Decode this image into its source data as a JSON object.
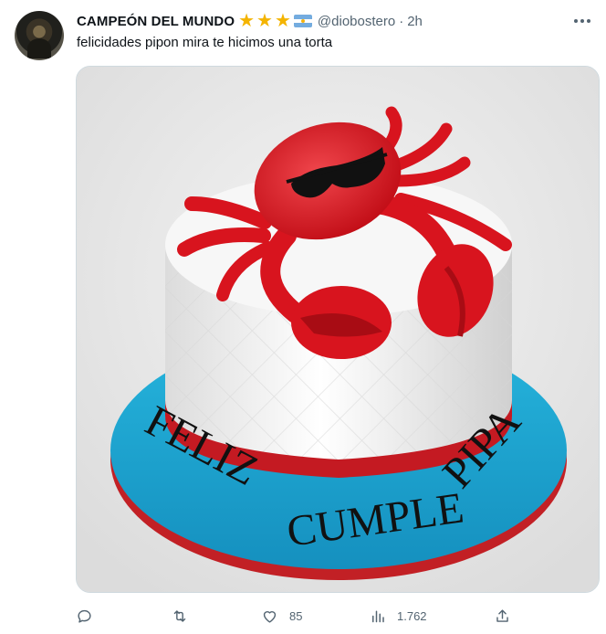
{
  "tweet": {
    "display_name": "CAMPEÓN DEL MUNDO",
    "badges": [
      "star-icon",
      "star-icon",
      "star-icon",
      "argentina-flag-icon"
    ],
    "handle": "@diobostero",
    "separator": "·",
    "time": "2h",
    "text": "felicidades pipon mira te hicimos una torta"
  },
  "media": {
    "cake_text": {
      "line1": "FELIZ",
      "line2": "CUMPLE",
      "line3": "PIPA"
    }
  },
  "actions": {
    "reply": {
      "icon": "reply-icon",
      "count": ""
    },
    "retweet": {
      "icon": "retweet-icon",
      "count": ""
    },
    "like": {
      "icon": "heart-icon",
      "count": "85"
    },
    "views": {
      "icon": "views-icon",
      "count": "1.762"
    },
    "share": {
      "icon": "share-icon",
      "count": ""
    }
  },
  "colors": {
    "text": "#0f1419",
    "secondary": "#536471",
    "star": "#f4b400",
    "cake_blue": "#1fa8d3",
    "crab_red": "#d8141e"
  }
}
